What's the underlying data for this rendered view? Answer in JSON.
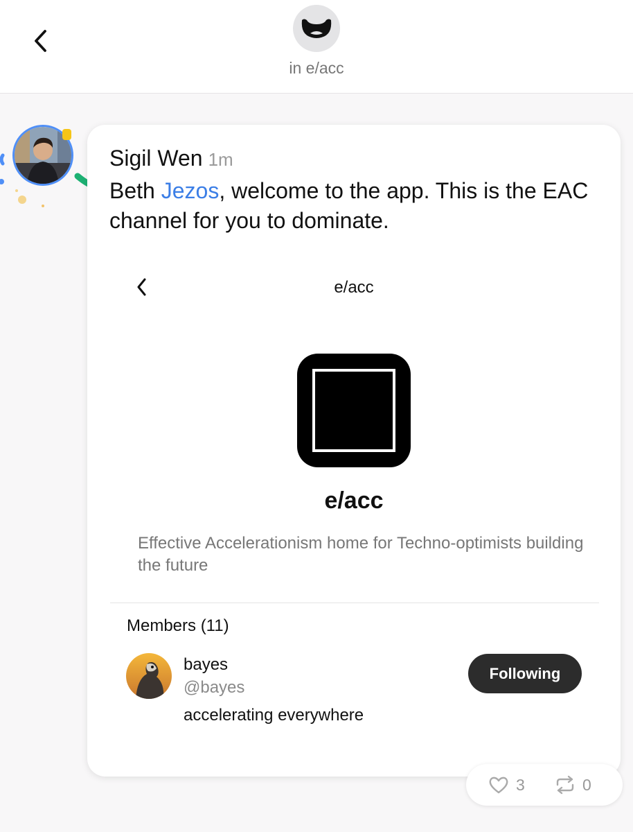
{
  "header": {
    "channel_caption": "in e/acc",
    "back_icon": "chevron-left-icon",
    "channel_avatar_icon": "mask-icon"
  },
  "post": {
    "author": "Sigil Wen",
    "time": "1m",
    "text_before_mention": "Beth ",
    "mention": "Jezos",
    "text_after_mention": ", welcome to the app. This is the EAC channel for you to dominate.",
    "mention_color": "#3b7ee6"
  },
  "embed": {
    "title": "e/acc",
    "back_icon": "chevron-left-icon",
    "logo_icon": "eacc-logo-icon",
    "channel_name": "e/acc",
    "description": "Effective Accelerationism home for Techno-optimists building the future",
    "members_heading": "Members (11)",
    "member": {
      "name": "bayes",
      "handle": "@bayes",
      "bio": "accelerating everywhere",
      "button_label": "Following"
    }
  },
  "reactions": {
    "likes": "3",
    "reposts": "0",
    "like_icon": "heart-icon",
    "repost_icon": "repost-icon"
  }
}
